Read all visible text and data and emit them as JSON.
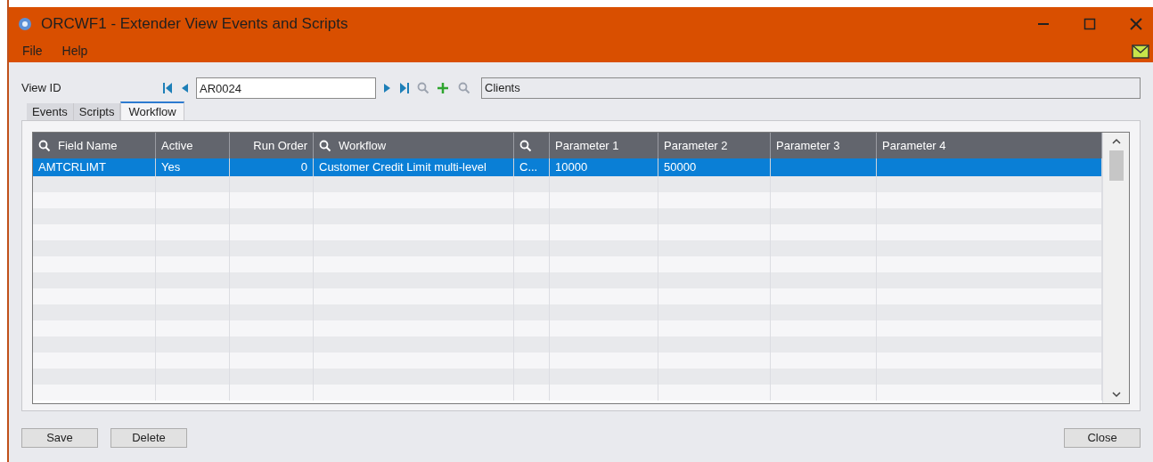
{
  "window": {
    "title": "ORCWF1 - Extender View Events and Scripts"
  },
  "menu": [
    "File",
    "Help"
  ],
  "view_id": {
    "label": "View ID",
    "value": "AR0024",
    "description": "Clients"
  },
  "tabs": [
    {
      "label": "Events",
      "selected": false
    },
    {
      "label": "Scripts",
      "selected": false
    },
    {
      "label": "Workflow",
      "selected": true
    }
  ],
  "table": {
    "columns": [
      {
        "label": "Field Name",
        "search": true
      },
      {
        "label": "Active",
        "search": false
      },
      {
        "label": "Run Order",
        "search": false
      },
      {
        "label": "Workflow",
        "search": true
      },
      {
        "search": true
      },
      {
        "label": "Parameter 1",
        "search": false
      },
      {
        "label": "Parameter 2",
        "search": false
      },
      {
        "label": "Parameter 3",
        "search": false
      },
      {
        "label": "Parameter 4",
        "search": false
      }
    ],
    "rows": [
      {
        "selected": true,
        "cells": [
          "AMTCRLIMT",
          "Yes",
          "0",
          "Customer Credit Limit multi-level",
          "C...",
          "10000",
          "50000",
          "",
          ""
        ]
      }
    ]
  },
  "buttons": {
    "left": [
      "Save",
      "Delete"
    ],
    "right": [
      "Close"
    ]
  }
}
